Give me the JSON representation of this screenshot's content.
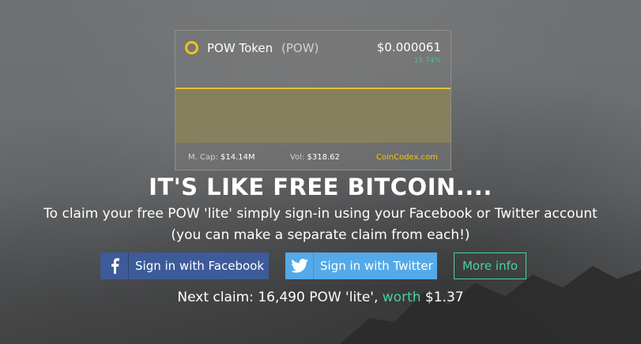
{
  "widget": {
    "token_name": "POW Token",
    "token_symbol": "(POW)",
    "price": "$0.000061",
    "change": "18.74%",
    "market_cap_label": "M. Cap:",
    "market_cap_value": "$14.14M",
    "volume_label": "Vol:",
    "volume_value": "$318.62",
    "source": "CoinCodex.com",
    "colors": {
      "coin": "#f0c419",
      "change": "#45c28a",
      "area": "#86805e"
    }
  },
  "headline": "IT'S LIKE FREE BITCOIN....",
  "subtext_line1": "To claim your free POW 'lite' simply sign-in using your Facebook or Twitter account",
  "subtext_line2": "(you can make a separate claim from each!)",
  "buttons": {
    "facebook": "Sign in with Facebook",
    "twitter": "Sign in with Twitter",
    "more_info": "More info"
  },
  "next_claim": {
    "prefix": "Next claim: 16,490 POW 'lite',",
    "worth_label": "worth",
    "value": "$1.37"
  },
  "icons": {
    "facebook": "facebook-icon",
    "twitter": "twitter-bird-icon",
    "coin": "coin-icon"
  }
}
